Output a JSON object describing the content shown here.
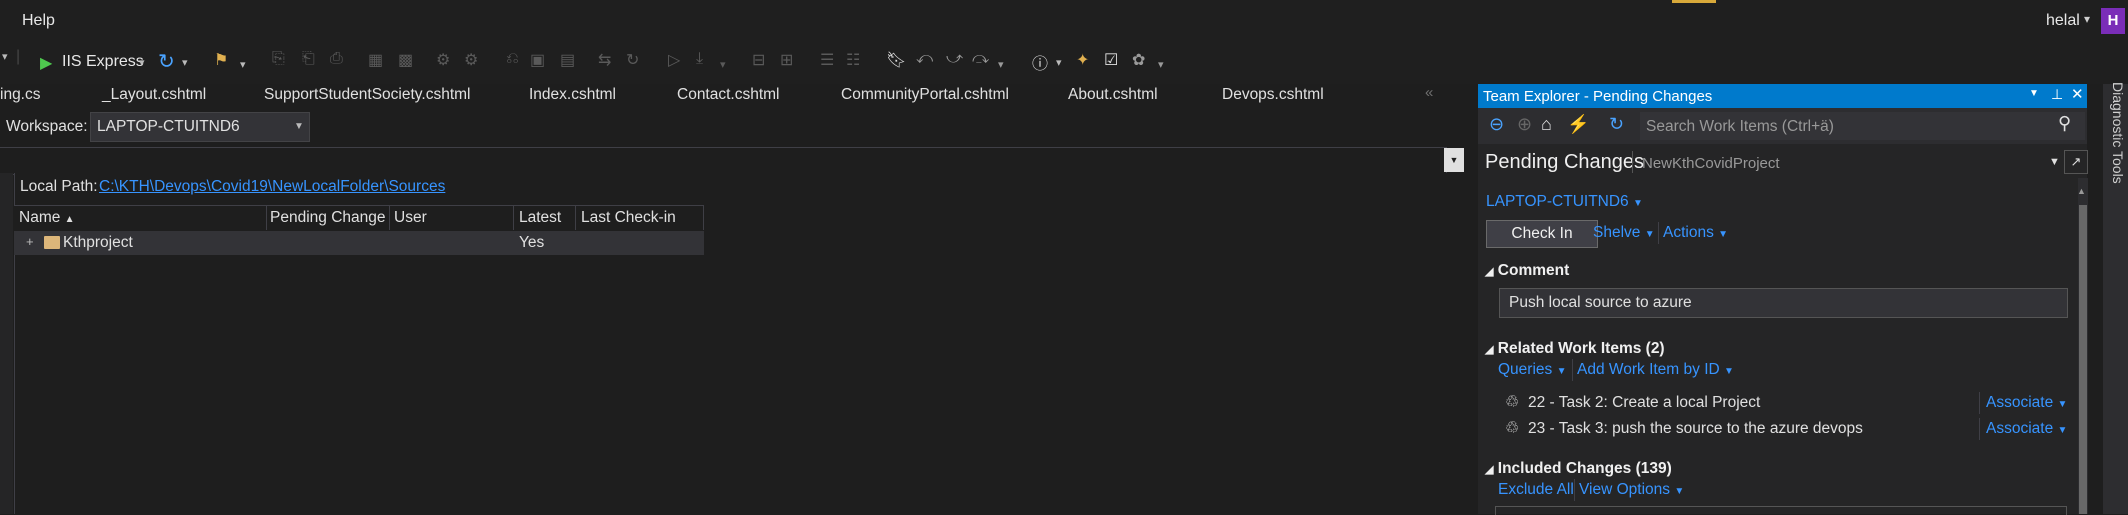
{
  "menu": {
    "help": "Help"
  },
  "user": {
    "name": "helal",
    "avatar": "H"
  },
  "toolbar": {
    "run_label": "IIS Express"
  },
  "tabs": [
    "ing.cs",
    "_Layout.cshtml",
    "SupportStudentSociety.cshtml",
    "Index.cshtml",
    "Contact.cshtml",
    "CommunityPortal.cshtml",
    "About.cshtml",
    "Devops.cshtml"
  ],
  "tab_overflow": "«",
  "source_control": {
    "workspace_label": "Workspace:",
    "workspace_value": "LAPTOP-CTUITND6",
    "local_path_label": "Local Path:",
    "local_path_value": "C:\\KTH\\Devops\\Covid19\\NewLocalFolder\\Sources",
    "columns": {
      "name": "Name",
      "pending_change": "Pending Change",
      "user": "User",
      "latest": "Latest",
      "last_checkin": "Last Check-in"
    },
    "rows": [
      {
        "name": "Kthproject",
        "pending_change": "",
        "user": "",
        "latest": "Yes",
        "last_checkin": ""
      }
    ]
  },
  "team_explorer": {
    "title": "Team Explorer - Pending Changes",
    "search_placeholder": "Search Work Items (Ctrl+ä)",
    "page_title": "Pending Changes",
    "project": "NewKthCovidProject",
    "workspace": "LAPTOP-CTUITND6",
    "check_in": "Check In",
    "shelve": "Shelve",
    "actions": "Actions",
    "comment_header": "Comment",
    "comment_value": "Push local source to azure",
    "related_header": "Related Work Items (2)",
    "queries": "Queries",
    "add_work_item": "Add Work Item by ID",
    "work_items": [
      {
        "text": "22 - Task 2: Create a local Project",
        "action": "Associate"
      },
      {
        "text": "23 - Task 3: push the source to the azure devops",
        "action": "Associate"
      }
    ],
    "included_header": "Included Changes (139)",
    "exclude_all": "Exclude All",
    "view_options": "View Options"
  },
  "side": {
    "diagnostic_tools": "Diagnostic Tools"
  },
  "colors": {
    "accent": "#007acc",
    "link": "#3794ff",
    "background": "#1e1e1e",
    "panel": "#252526"
  }
}
